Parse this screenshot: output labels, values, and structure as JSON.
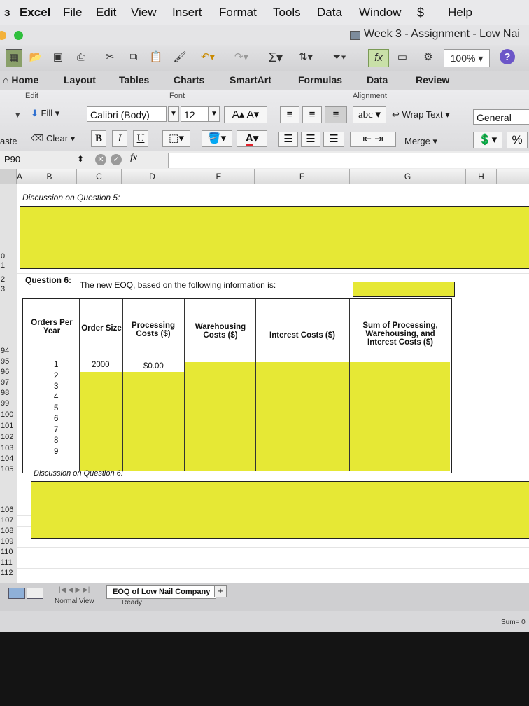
{
  "menubar": {
    "items": [
      "Excel",
      "File",
      "Edit",
      "View",
      "Insert",
      "Format",
      "Tools",
      "Data",
      "Window",
      "Help"
    ]
  },
  "window": {
    "title": "Week 3 - Assignment - Low Nai"
  },
  "toolbar": {
    "zoom": "100%"
  },
  "ribbon": {
    "tabs": [
      "Home",
      "Layout",
      "Tables",
      "Charts",
      "SmartArt",
      "Formulas",
      "Data",
      "Review"
    ],
    "groups": {
      "edit": "Edit",
      "font": "Font",
      "alignment": "Alignment"
    },
    "fill_label": "Fill",
    "clear_label": "Clear",
    "paste_label": "aste",
    "font_name": "Calibri (Body)",
    "font_size": "12",
    "wrap_text_label": "Wrap Text",
    "merge_label": "Merge",
    "number_format": "General",
    "percent": "%",
    "abc": "abc"
  },
  "formula_bar": {
    "cell_ref": "P90",
    "fx": "fx"
  },
  "columns": [
    "A",
    "B",
    "C",
    "D",
    "E",
    "F",
    "G",
    "H"
  ],
  "rows": {
    "top_labels": [
      "0",
      "1",
      "2",
      "3"
    ],
    "mid_labels": [
      "94",
      "95",
      "96",
      "97",
      "98",
      "99",
      "100",
      "101",
      "102",
      "103",
      "104",
      "105"
    ],
    "low_labels": [
      "106",
      "107",
      "108",
      "109",
      "110",
      "111",
      "112"
    ]
  },
  "sheet": {
    "discussion_q5": "Discussion on Question 5:",
    "question6_label": "Question 6:",
    "question6_text": "The new EOQ, based on the following information is:",
    "table": {
      "headers": {
        "orders_per_year": "Orders Per Year",
        "order_size": "Order Size",
        "processing": "Processing Costs ($)",
        "warehousing": "Warehousing Costs ($)",
        "interest": "Interest Costs ($)",
        "sum": "Sum of Processing, Warehousing, and Interest Costs ($)"
      },
      "orders": [
        "1",
        "2",
        "3",
        "4",
        "5",
        "6",
        "7",
        "8",
        "9"
      ],
      "first_order_size": "2000",
      "first_processing": "$0.00"
    },
    "discussion_q6": "Discussion on Question 6:"
  },
  "sheet_tabs": {
    "active": "EOQ of Low Nail Company",
    "add": "+"
  },
  "status": {
    "view": "Normal View",
    "ready": "Ready",
    "sum": "Sum= 0"
  },
  "colors": {
    "highlight": "#e6e835"
  }
}
